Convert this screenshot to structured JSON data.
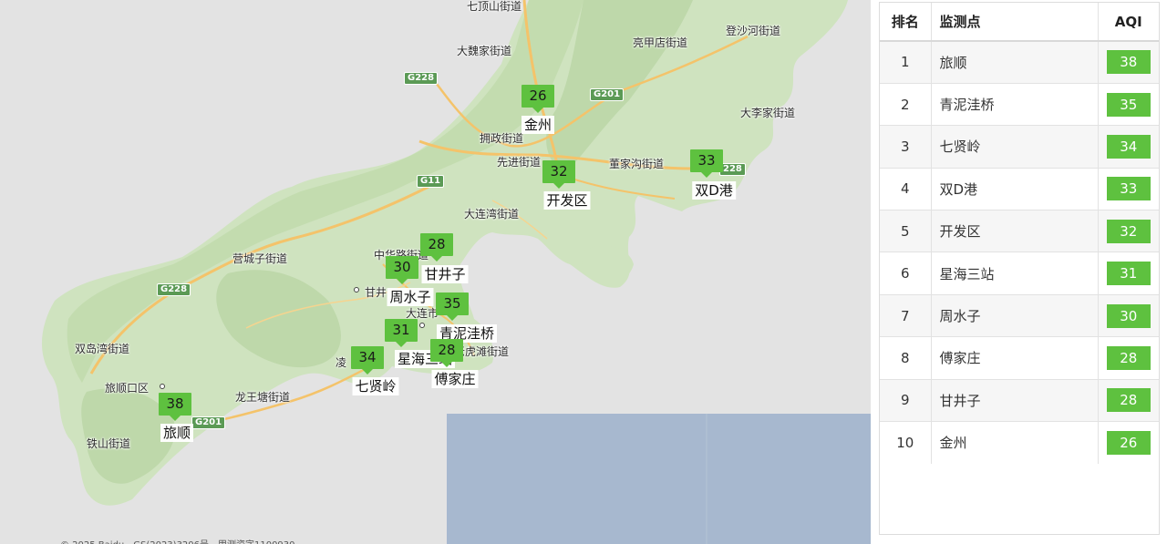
{
  "map": {
    "accent_color": "#5ec13f",
    "place_labels": [
      {
        "id": "qidingshan",
        "text": "七顶山街道"
      },
      {
        "id": "dawei",
        "text": "大魏家街道"
      },
      {
        "id": "liangjiadian",
        "text": "亮甲店街道"
      },
      {
        "id": "dengshahe",
        "text": "登沙河街道"
      },
      {
        "id": "dalijia",
        "text": "大李家街道"
      },
      {
        "id": "yongzheng",
        "text": "拥政街道"
      },
      {
        "id": "xianjin",
        "text": "先进街道"
      },
      {
        "id": "dongjiagou",
        "text": "董家沟街道"
      },
      {
        "id": "dalianwan",
        "text": "大连湾街道"
      },
      {
        "id": "yingchengzi",
        "text": "营城子街道"
      },
      {
        "id": "zhonghualu",
        "text": "中华路街道"
      },
      {
        "id": "ganjing",
        "text": "甘井"
      },
      {
        "id": "dalianshi",
        "text": "大连市"
      },
      {
        "id": "xianta",
        "text": "老虎滩街道"
      },
      {
        "id": "shuangdaowan",
        "text": "双岛湾街道"
      },
      {
        "id": "lvshunkou",
        "text": "旅顺口区"
      },
      {
        "id": "longwangtang",
        "text": "龙王塘街道"
      },
      {
        "id": "tieshan",
        "text": "铁山街道"
      },
      {
        "id": "ling",
        "text": "凌"
      }
    ],
    "road_shields": [
      {
        "id": "g228a",
        "text": "G228"
      },
      {
        "id": "g201a",
        "text": "G201"
      },
      {
        "id": "g11",
        "text": "G11"
      },
      {
        "id": "g228b",
        "text": "G228"
      },
      {
        "id": "g201b",
        "text": "G201"
      },
      {
        "id": "g228c",
        "text": "228"
      }
    ],
    "markers": [
      {
        "site": "金州",
        "aqi": "26"
      },
      {
        "site": "开发区",
        "aqi": "32"
      },
      {
        "site": "双D港",
        "aqi": "33"
      },
      {
        "site": "甘井子",
        "aqi": "28"
      },
      {
        "site": "周水子",
        "aqi": "30"
      },
      {
        "site": "青泥洼桥",
        "aqi": "35"
      },
      {
        "site": "星海三站",
        "aqi": "31"
      },
      {
        "site": "傅家庄",
        "aqi": "28"
      },
      {
        "site": "七贤岭",
        "aqi": "34"
      },
      {
        "site": "旅顺",
        "aqi": "38"
      }
    ],
    "copyright": "© 2025 Baidu - GS(2023)3206号 - 甲测资字1100930"
  },
  "table": {
    "headers": {
      "rank": "排名",
      "site": "监测点",
      "aqi": "AQI"
    },
    "rows": [
      {
        "rank": "1",
        "site": "旅顺",
        "aqi": "38"
      },
      {
        "rank": "2",
        "site": "青泥洼桥",
        "aqi": "35"
      },
      {
        "rank": "3",
        "site": "七贤岭",
        "aqi": "34"
      },
      {
        "rank": "4",
        "site": "双D港",
        "aqi": "33"
      },
      {
        "rank": "5",
        "site": "开发区",
        "aqi": "32"
      },
      {
        "rank": "6",
        "site": "星海三站",
        "aqi": "31"
      },
      {
        "rank": "7",
        "site": "周水子",
        "aqi": "30"
      },
      {
        "rank": "8",
        "site": "傅家庄",
        "aqi": "28"
      },
      {
        "rank": "9",
        "site": "甘井子",
        "aqi": "28"
      },
      {
        "rank": "10",
        "site": "金州",
        "aqi": "26"
      }
    ]
  }
}
